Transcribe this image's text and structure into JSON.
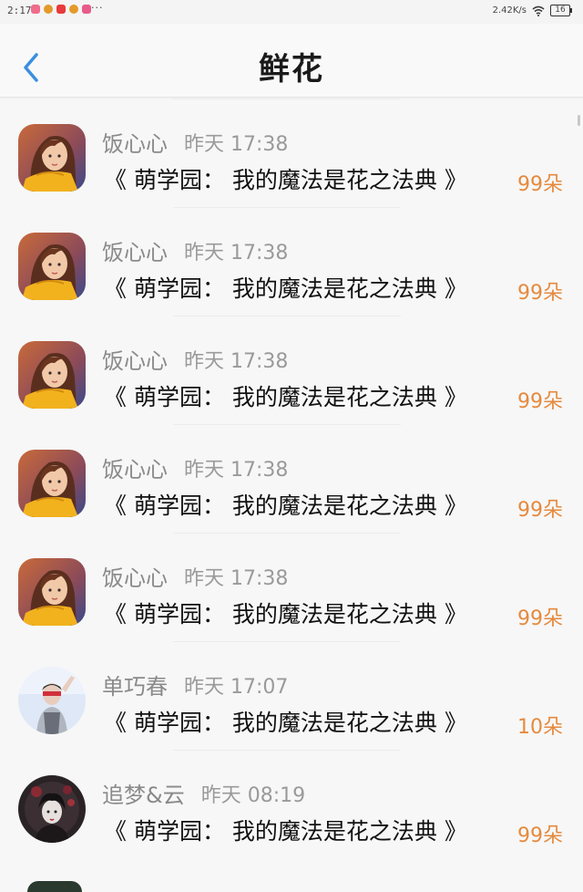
{
  "status_bar": {
    "time": "2:17",
    "more": "···",
    "network_speed": "2.42K/s",
    "battery": "16",
    "app_icon_colors": [
      "#f06a8a",
      "#e39a2a",
      "#e83a3a",
      "#e39a2a",
      "#e85a8a"
    ]
  },
  "header": {
    "back_icon": "chevron-left-icon",
    "title": "鲜花"
  },
  "list": [
    {
      "name": "饭心心",
      "time": "昨天 17:38",
      "book": "《 萌学园： 我的魔法是花之法典 》",
      "count": "99朵",
      "avatar": "girl-yellow-scarf"
    },
    {
      "name": "饭心心",
      "time": "昨天 17:38",
      "book": "《 萌学园： 我的魔法是花之法典 》",
      "count": "99朵",
      "avatar": "girl-yellow-scarf"
    },
    {
      "name": "饭心心",
      "time": "昨天 17:38",
      "book": "《 萌学园： 我的魔法是花之法典 》",
      "count": "99朵",
      "avatar": "girl-yellow-scarf"
    },
    {
      "name": "饭心心",
      "time": "昨天 17:38",
      "book": "《 萌学园： 我的魔法是花之法典 》",
      "count": "99朵",
      "avatar": "girl-yellow-scarf"
    },
    {
      "name": "饭心心",
      "time": "昨天 17:38",
      "book": "《 萌学园： 我的魔法是花之法典 》",
      "count": "99朵",
      "avatar": "girl-yellow-scarf"
    },
    {
      "name": "单巧春",
      "time": "昨天 17:07",
      "book": "《 萌学园： 我的魔法是花之法典 》",
      "count": "10朵",
      "avatar": "girl-photo"
    },
    {
      "name": "追梦&云",
      "time": "昨天 08:19",
      "book": "《 萌学园： 我的魔法是花之法典 》",
      "count": "99朵",
      "avatar": "dark-illustration"
    }
  ],
  "colors": {
    "accent_blue": "#3b8fe0",
    "count_orange": "#e58a3e"
  }
}
